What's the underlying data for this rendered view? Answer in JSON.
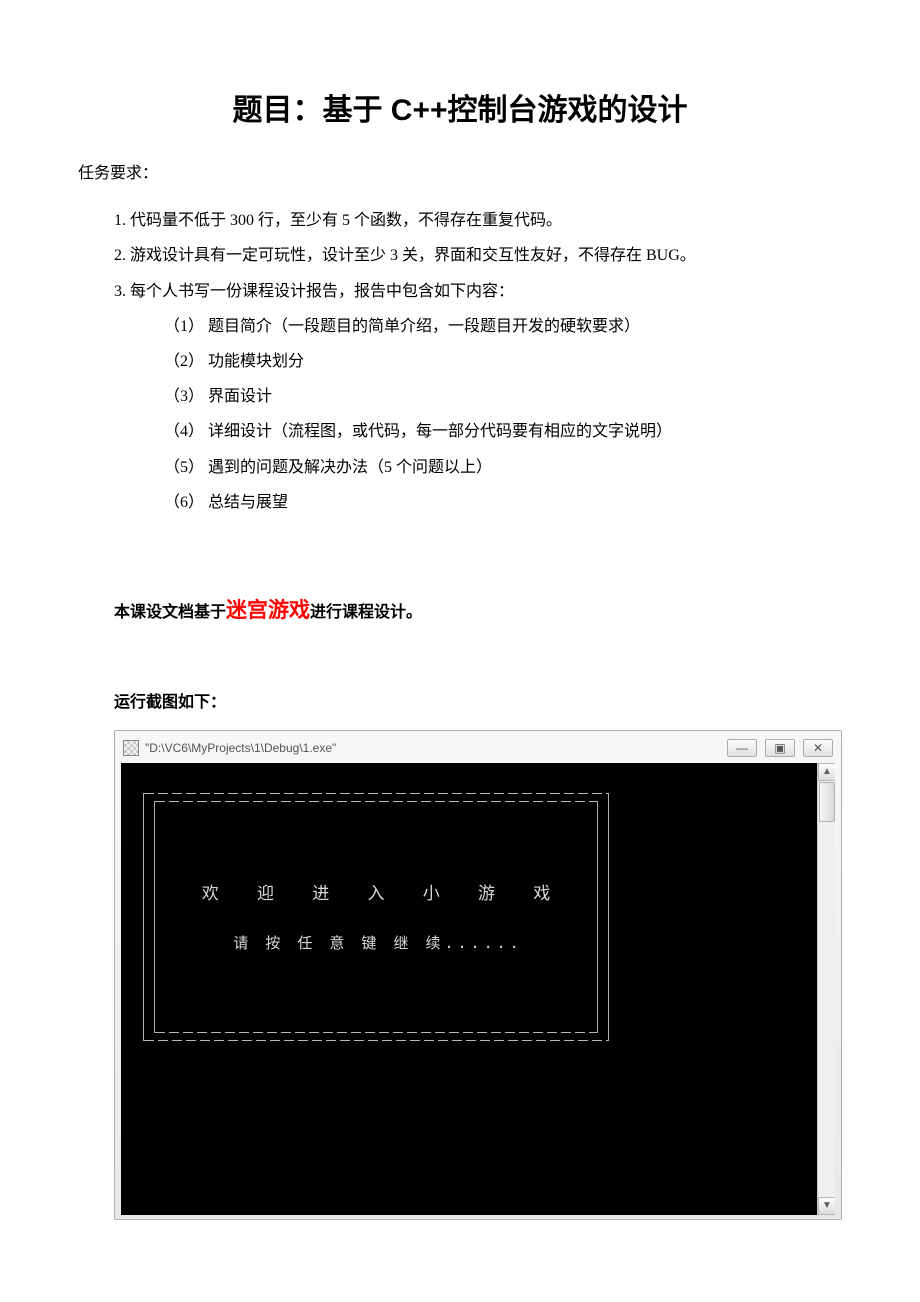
{
  "title": "题目：基于 C++控制台游戏的设计",
  "sectionHeading": "任务要求：",
  "requirements": [
    "1. 代码量不低于 300 行，至少有 5 个函数，不得存在重复代码。",
    "2. 游戏设计具有一定可玩性，设计至少 3 关，界面和交互性友好，不得存在 BUG。",
    "3. 每个人书写一份课程设计报告，报告中包含如下内容："
  ],
  "subitems": [
    "（1） 题目简介（一段题目的简单介绍，一段题目开发的硬软要求）",
    "（2） 功能模块划分",
    "（3） 界面设计",
    "（4） 详细设计（流程图，或代码，每一部分代码要有相应的文字说明）",
    "（5） 遇到的问题及解决办法（5 个问题以上）",
    "（6） 总结与展望"
  ],
  "designBasis": {
    "prefix": "本课设文档基于",
    "highlight": "迷宫游戏",
    "suffix": "进行课程设计。"
  },
  "screenshotLabel": "运行截图如下：",
  "window": {
    "path": "\"D:\\VC6\\MyProjects\\1\\Debug\\1.exe\"",
    "minimize": "—",
    "maximize": "▣",
    "close": "✕",
    "arrowUp": "▲",
    "arrowDown": "▼"
  },
  "console": {
    "welcome": "欢 迎 进 入 小 游 戏",
    "continue": "请 按 任 意 键 继 续......"
  }
}
